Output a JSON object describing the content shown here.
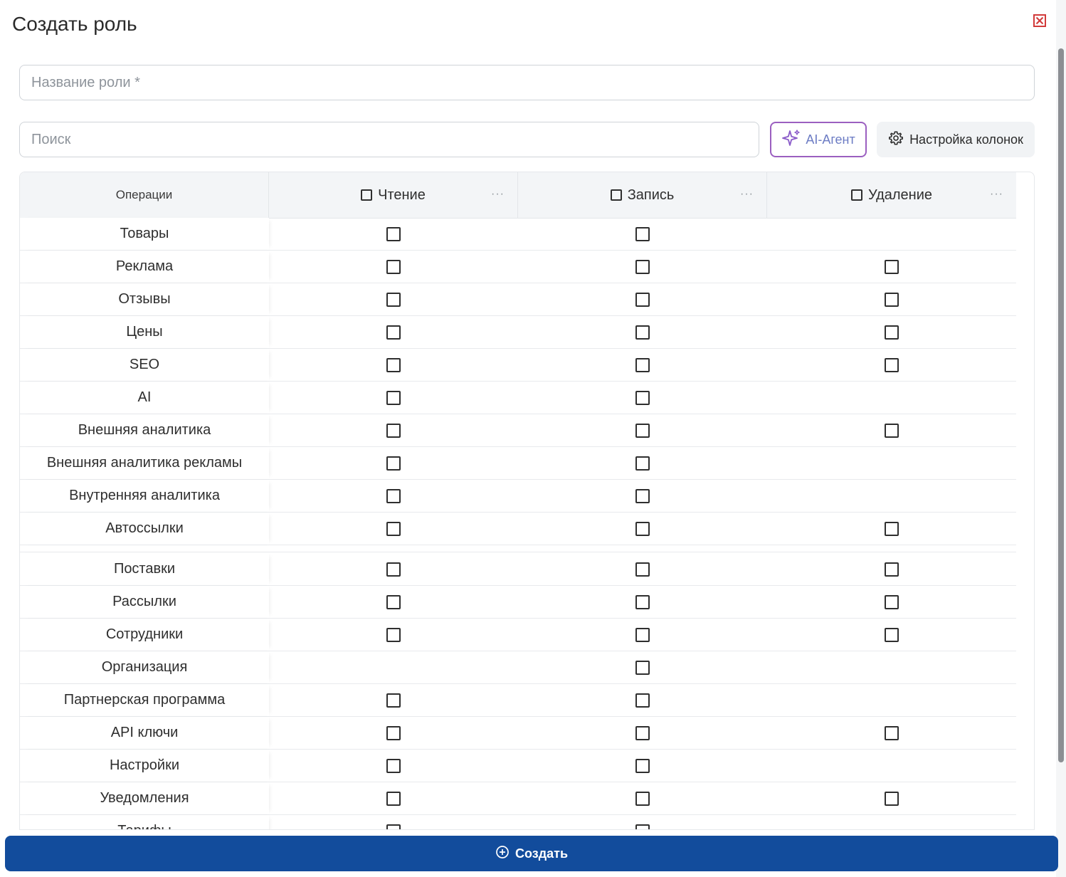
{
  "title": "Создать роль",
  "role_name": {
    "placeholder": "Название роли *",
    "value": ""
  },
  "search": {
    "placeholder": "Поиск",
    "value": ""
  },
  "toolbar": {
    "ai_label": "AI-Агент",
    "columns_label": "Настройка колонок"
  },
  "table": {
    "headers": {
      "operations": "Операции",
      "read": "Чтение",
      "write": "Запись",
      "delete": "Удаление",
      "menu": "···"
    },
    "rows": [
      {
        "label": "Товары",
        "read": true,
        "write": true,
        "delete": false
      },
      {
        "label": "Реклама",
        "read": true,
        "write": true,
        "delete": true
      },
      {
        "label": "Отзывы",
        "read": true,
        "write": true,
        "delete": true
      },
      {
        "label": "Цены",
        "read": true,
        "write": true,
        "delete": true
      },
      {
        "label": "SEO",
        "read": true,
        "write": true,
        "delete": true
      },
      {
        "label": "AI",
        "read": true,
        "write": true,
        "delete": false
      },
      {
        "label": "Внешняя аналитика",
        "read": true,
        "write": true,
        "delete": true
      },
      {
        "label": "Внешняя аналитика рекламы",
        "read": true,
        "write": true,
        "delete": false
      },
      {
        "label": "Внутренняя аналитика",
        "read": true,
        "write": true,
        "delete": false
      },
      {
        "label": "Автоссылки",
        "read": true,
        "write": true,
        "delete": true
      },
      {
        "label": "Поставки",
        "read": true,
        "write": true,
        "delete": true
      },
      {
        "label": "Рассылки",
        "read": true,
        "write": true,
        "delete": true
      },
      {
        "label": "Сотрудники",
        "read": true,
        "write": true,
        "delete": true
      },
      {
        "label": "Организация",
        "read": false,
        "write": true,
        "delete": false
      },
      {
        "label": "Партнерская программа",
        "read": true,
        "write": true,
        "delete": false
      },
      {
        "label": "API ключи",
        "read": true,
        "write": true,
        "delete": true
      },
      {
        "label": "Настройки",
        "read": true,
        "write": true,
        "delete": false
      },
      {
        "label": "Уведомления",
        "read": true,
        "write": true,
        "delete": true
      },
      {
        "label": "Тарифы",
        "read": true,
        "write": true,
        "delete": false
      }
    ]
  },
  "footer": {
    "create_label": "Создать"
  }
}
